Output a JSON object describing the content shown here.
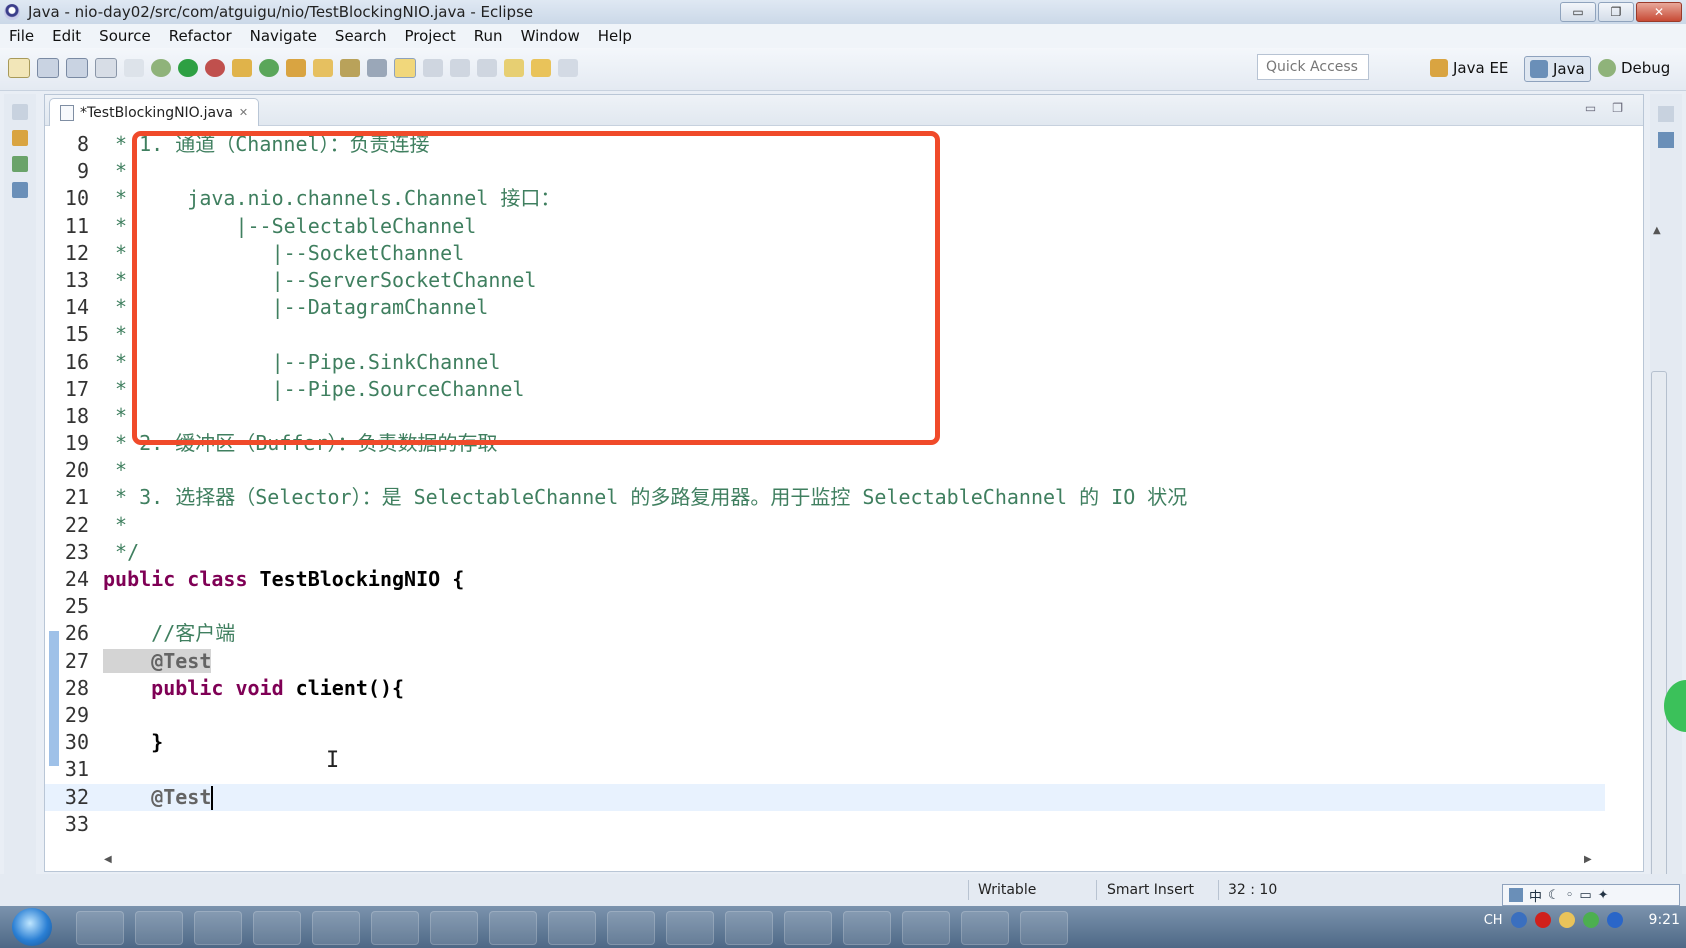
{
  "window": {
    "title": "Java - nio-day02/src/com/atguigu/nio/TestBlockingNIO.java - Eclipse"
  },
  "menu": [
    "File",
    "Edit",
    "Source",
    "Refactor",
    "Navigate",
    "Search",
    "Project",
    "Run",
    "Window",
    "Help"
  ],
  "toolbar": {
    "quick_access": "Quick Access",
    "perspectives": [
      "Java EE",
      "Java",
      "Debug"
    ]
  },
  "editor": {
    "tab": {
      "label": "*TestBlockingNIO.java"
    },
    "lines": [
      {
        "n": "8",
        "t": " * 1. 通道（Channel）：负责连接",
        "k": "cmt"
      },
      {
        "n": "9",
        "t": " *",
        "k": "cmt"
      },
      {
        "n": "10",
        "t": " *     java.nio.channels.Channel 接口：",
        "k": "cmt"
      },
      {
        "n": "11",
        "t": " *         |--SelectableChannel",
        "k": "cmt"
      },
      {
        "n": "12",
        "t": " *            |--SocketChannel",
        "k": "cmt"
      },
      {
        "n": "13",
        "t": " *            |--ServerSocketChannel",
        "k": "cmt"
      },
      {
        "n": "14",
        "t": " *            |--DatagramChannel",
        "k": "cmt"
      },
      {
        "n": "15",
        "t": " *",
        "k": "cmt"
      },
      {
        "n": "16",
        "t": " *            |--Pipe.SinkChannel",
        "k": "cmt"
      },
      {
        "n": "17",
        "t": " *            |--Pipe.SourceChannel",
        "k": "cmt"
      },
      {
        "n": "18",
        "t": " *",
        "k": "cmt"
      },
      {
        "n": "19",
        "t": " * 2. 缓冲区（Buffer）：负责数据的存取",
        "k": "cmt"
      },
      {
        "n": "20",
        "t": " *",
        "k": "cmt"
      },
      {
        "n": "21",
        "t": " * 3. 选择器（Selector）：是 SelectableChannel 的多路复用器。用于监控 SelectableChannel 的 IO 状况",
        "k": "cmt"
      },
      {
        "n": "22",
        "t": " *",
        "k": "cmt"
      },
      {
        "n": "23",
        "t": " */",
        "k": "cmt"
      },
      {
        "n": "24",
        "k": "class",
        "kw": "public class ",
        "id": "TestBlockingNIO {"
      },
      {
        "n": "25",
        "k": "blank"
      },
      {
        "n": "26",
        "t": "    //客户端",
        "k": "cmt"
      },
      {
        "n": "27",
        "t": "    @Test",
        "k": "annhl"
      },
      {
        "n": "28",
        "k": "method",
        "kw": "    public void ",
        "id": "client(){"
      },
      {
        "n": "29",
        "k": "blank"
      },
      {
        "n": "30",
        "t": "    }",
        "k": "plain"
      },
      {
        "n": "31",
        "k": "blank"
      },
      {
        "n": "32",
        "t": "    @Test",
        "k": "cur"
      },
      {
        "n": "33",
        "k": "blank"
      }
    ]
  },
  "status": {
    "writable": "Writable",
    "insert_mode": "Smart Insert",
    "position": "32 : 10"
  },
  "ime": {
    "lang": "中"
  },
  "tray": {
    "lang": "CH",
    "time": "9:21"
  },
  "colors": {
    "highlight_box": "#f04a2a",
    "comment": "#3f7f5f",
    "keyword": "#7f0055"
  }
}
